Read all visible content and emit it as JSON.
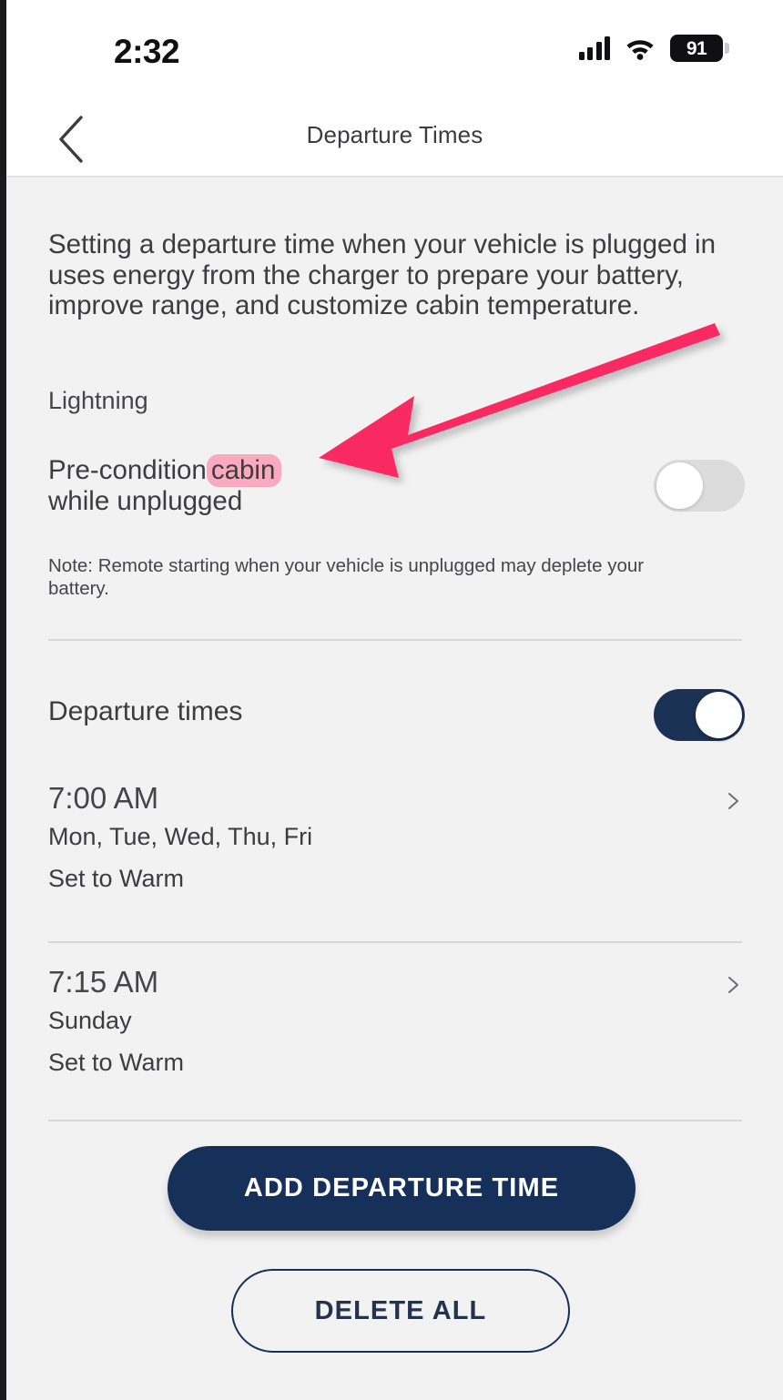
{
  "status_bar": {
    "time": "2:32",
    "battery_level": "91",
    "signal_icon": "cellular-signal-icon",
    "wifi_icon": "wifi-icon",
    "battery_icon": "battery-icon"
  },
  "header": {
    "back_icon": "chevron-left-icon",
    "title": "Departure Times"
  },
  "main": {
    "intro_text": "Setting a departure time when your vehicle is plugged in uses energy from the charger to prepare your battery, improve range, and customize cabin temperature.",
    "vehicle_name": "Lightning",
    "precondition": {
      "label_before": "Pre-condition",
      "label_highlight": "cabin",
      "label_after": "while unplugged",
      "toggle_state": "off",
      "note": "Note: Remote starting when your vehicle is unplugged may deplete your battery."
    },
    "departure_times": {
      "label": "Departure times",
      "toggle_state": "on",
      "entries": [
        {
          "time": "7:00 AM",
          "days": "Mon, Tue, Wed, Thu, Fri",
          "mode": "Set to Warm",
          "chevron_icon": "chevron-right-icon"
        },
        {
          "time": "7:15 AM",
          "days": "Sunday",
          "mode": "Set to Warm",
          "chevron_icon": "chevron-right-icon"
        }
      ]
    },
    "actions": {
      "add_label": "ADD DEPARTURE TIME",
      "delete_label": "DELETE ALL"
    }
  },
  "annotation": {
    "arrow_icon": "pointer-arrow-icon",
    "arrow_color": "#f92a62",
    "highlight_color": "#f9a9c0"
  },
  "colors": {
    "accent_navy": "#16305a",
    "toggle_on": "#1b3255",
    "toggle_off": "#dcdcdc",
    "page_background": "#f2f2f2",
    "header_background": "#ffffff"
  }
}
